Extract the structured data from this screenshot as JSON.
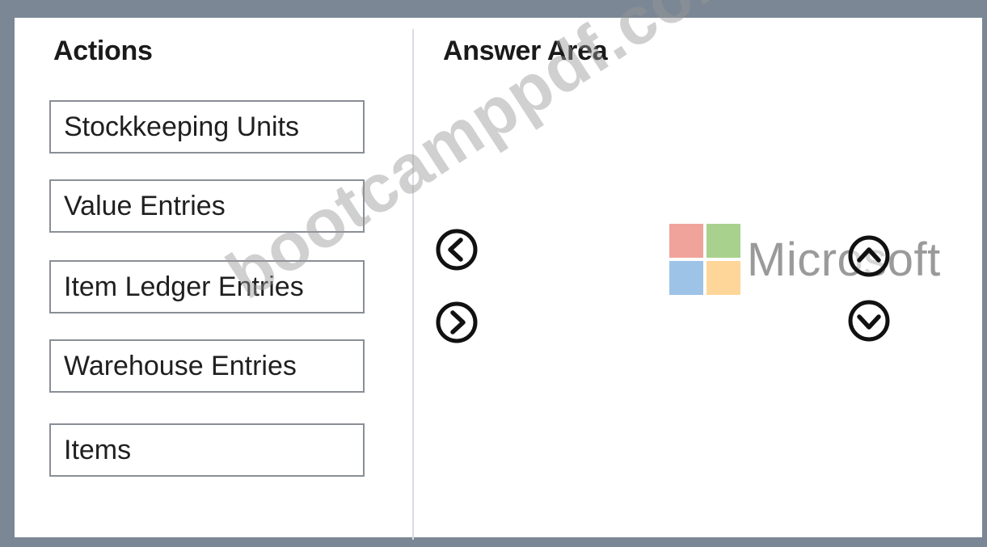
{
  "headings": {
    "actions": "Actions",
    "answer_area": "Answer Area"
  },
  "actions": [
    {
      "label": "Stockkeeping Units"
    },
    {
      "label": "Value Entries"
    },
    {
      "label": "Item Ledger Entries"
    },
    {
      "label": "Warehouse Entries"
    },
    {
      "label": "Items"
    }
  ],
  "controls": {
    "move_left_icon": "chevron-left-circle-icon",
    "move_right_icon": "chevron-right-circle-icon",
    "move_up_icon": "chevron-up-circle-icon",
    "move_down_icon": "chevron-down-circle-icon"
  },
  "logo": {
    "text": "Microsoft",
    "colors": [
      "#f0a39b",
      "#a9d18e",
      "#9dc3e6",
      "#ffd699"
    ]
  },
  "watermark": {
    "text": "bootcamppdf.com"
  }
}
